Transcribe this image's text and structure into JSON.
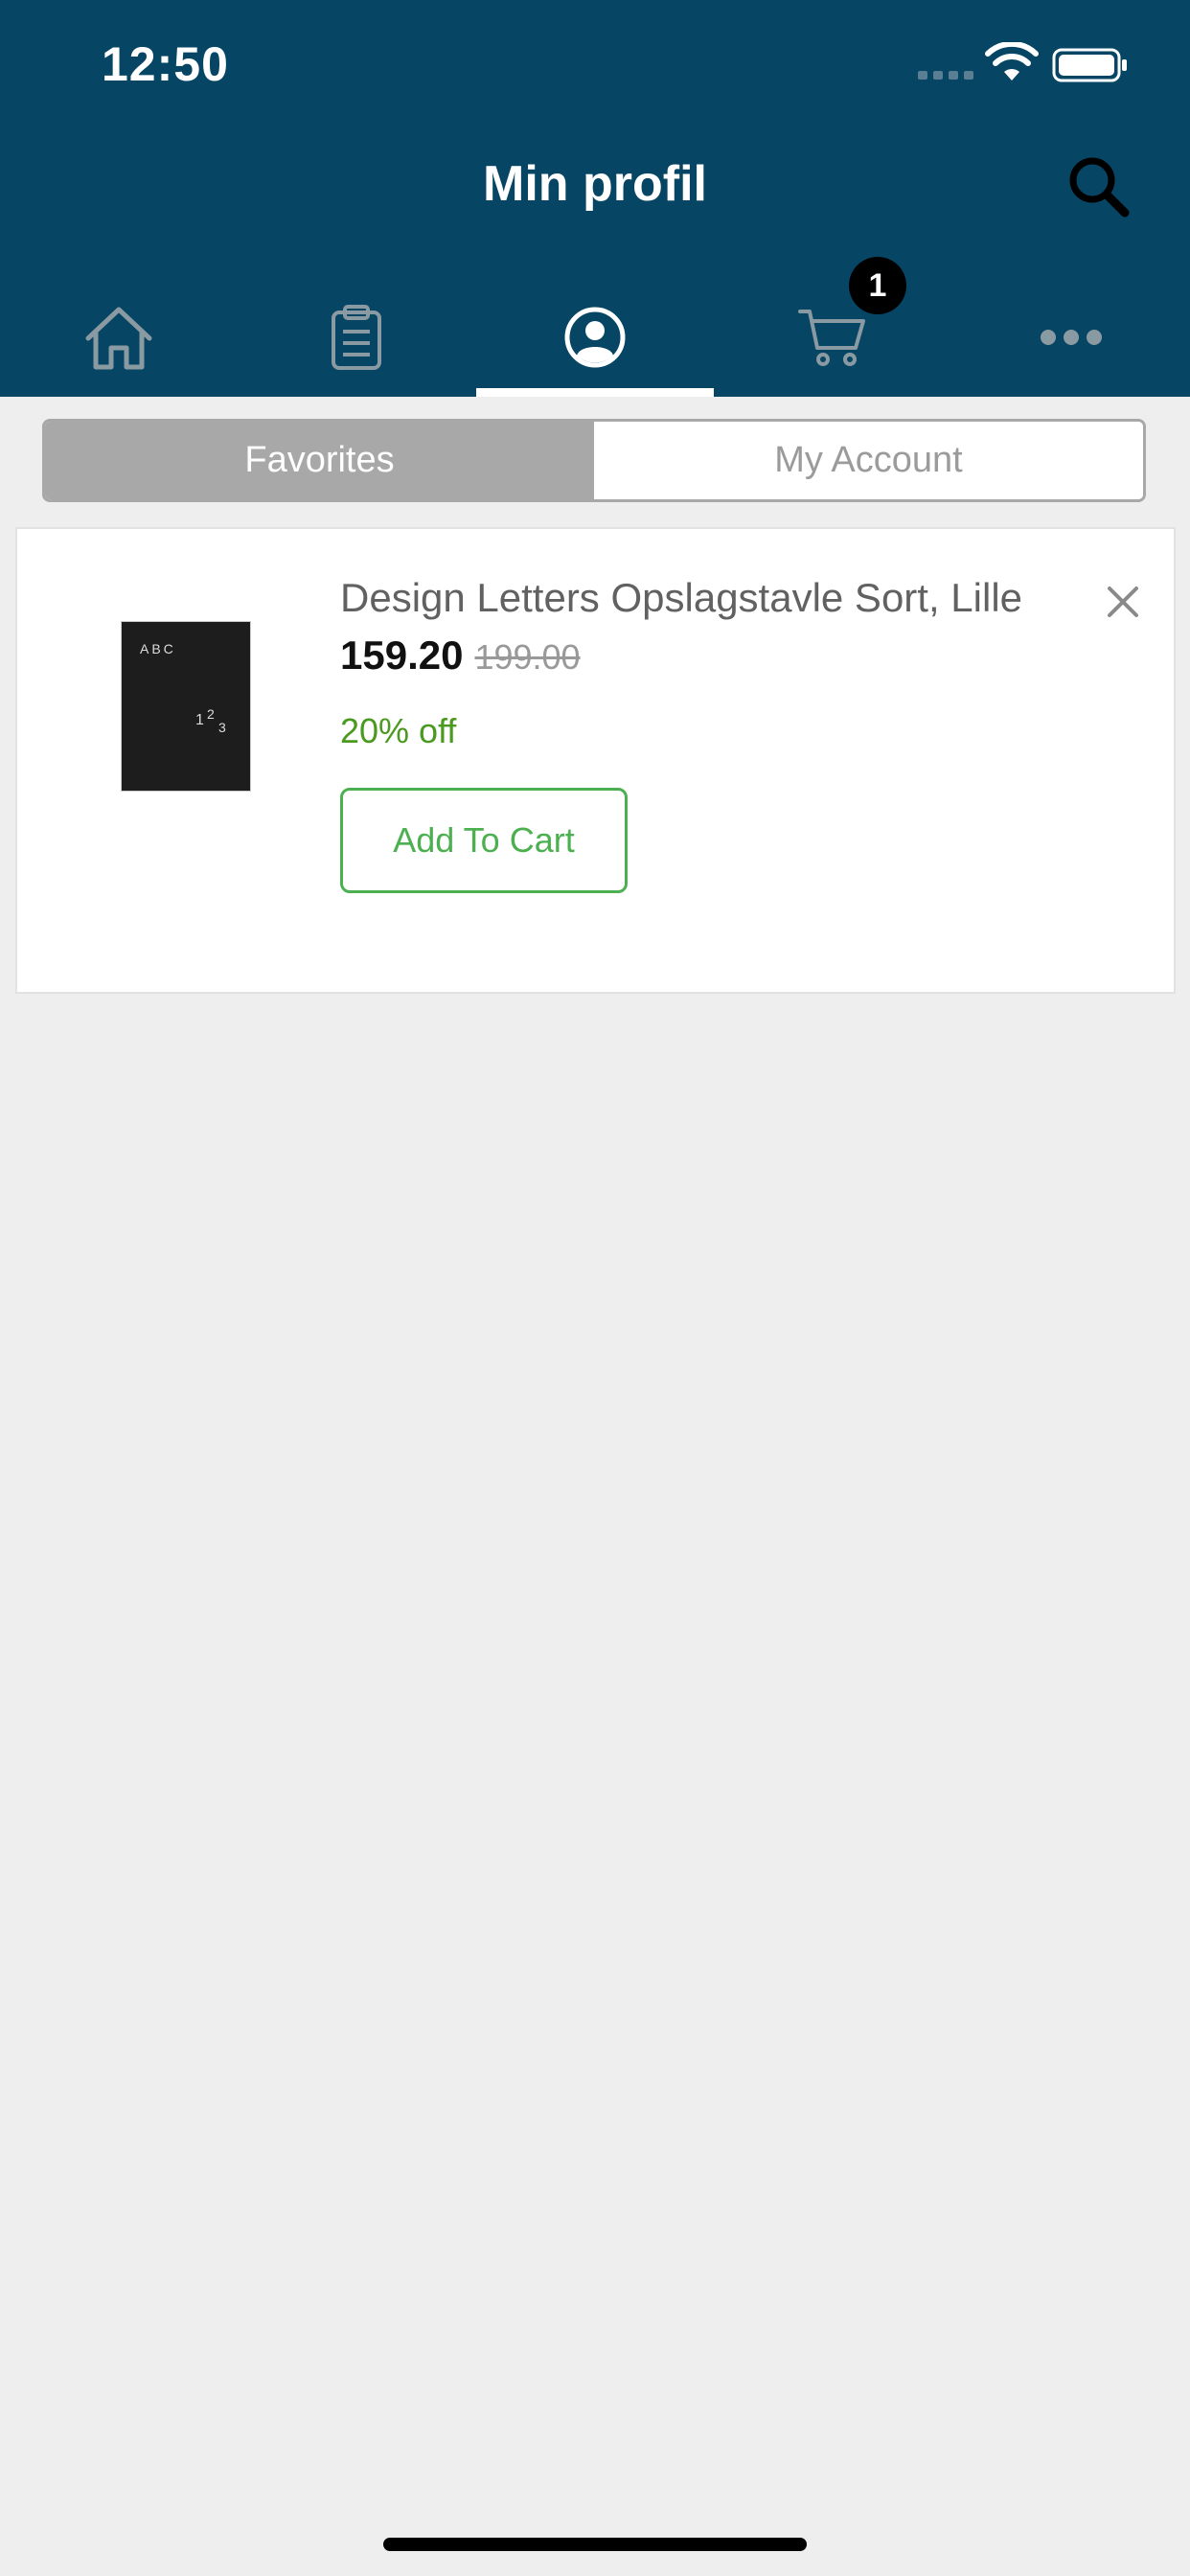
{
  "status_bar": {
    "time": "12:50"
  },
  "header": {
    "title": "Min profil"
  },
  "nav": {
    "tabs": [
      {
        "name": "home",
        "icon": "home-icon"
      },
      {
        "name": "orders",
        "icon": "clipboard-icon"
      },
      {
        "name": "profile",
        "icon": "profile-icon",
        "active": true
      },
      {
        "name": "cart",
        "icon": "cart-icon",
        "badge": "1"
      },
      {
        "name": "more",
        "icon": "more-icon"
      }
    ],
    "cart_badge": "1"
  },
  "segments": {
    "favorites": "Favorites",
    "account": "My Account",
    "selected": "Favorites"
  },
  "favorites": [
    {
      "name": "Design Letters Opslagstavle Sort, Lille",
      "price": "159.20",
      "old_price": "199.00",
      "discount": "20% off",
      "add_to_cart": "Add To Cart",
      "image_letters": {
        "top": "ABC",
        "d1": "1",
        "d2": "2",
        "d3": "3"
      }
    }
  ],
  "colors": {
    "header": "#064563",
    "background": "#eeeeee",
    "accent_green": "#4caf50",
    "discount_green": "#4a9a1f",
    "segment_selected": "#a8a8a8"
  }
}
